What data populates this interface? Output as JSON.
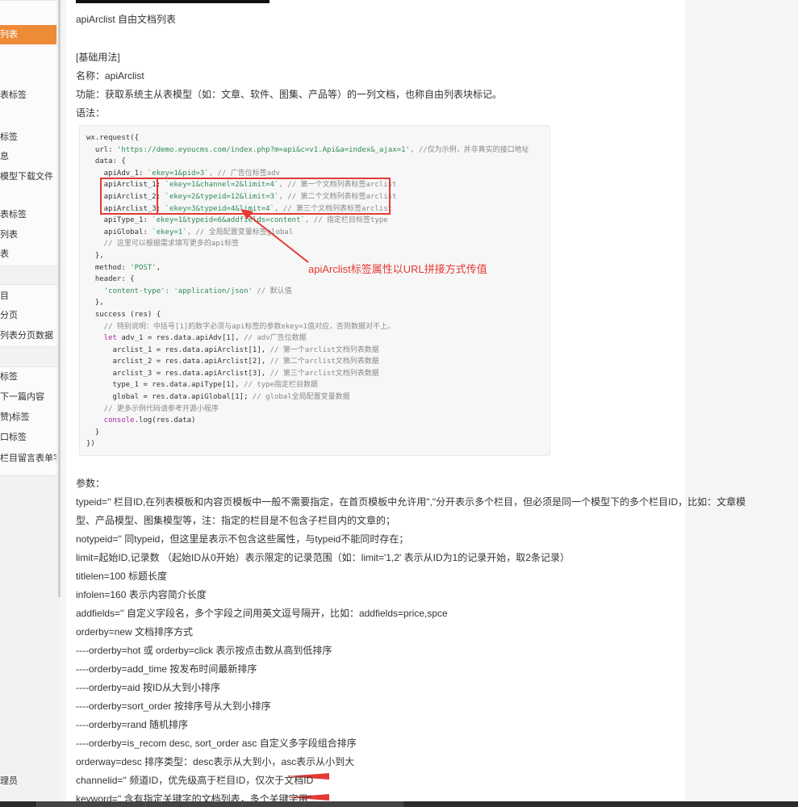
{
  "sidebar": {
    "items": [
      {
        "label": "列表",
        "active": true
      },
      {
        "label": "表标签"
      },
      {
        "label": "标签"
      },
      {
        "label": "息"
      },
      {
        "label": "模型下载文件"
      },
      {
        "label": "表标签"
      },
      {
        "label": "列表"
      },
      {
        "label": "表"
      },
      {
        "label": "目"
      },
      {
        "label": "分页"
      },
      {
        "label": "列表分页数据"
      },
      {
        "label": "标签"
      },
      {
        "label": "下一篇内容"
      },
      {
        "label": "赞)标签"
      },
      {
        "label": "口标签"
      },
      {
        "label": "栏目留言表单字"
      },
      {
        "label": "理员"
      }
    ]
  },
  "content": {
    "subtitle": "apiArclist 自由文档列表",
    "section_label": "[基础用法]",
    "name_line": "名称：apiArclist",
    "function_line": "功能：获取系统主从表模型（如：文章、软件、图集、产品等）的一列文档，也称自由列表块标记。",
    "syntax_label": "语法：",
    "code": {
      "l01": "wx.request({",
      "l02_a": "  url: ",
      "l02_s": "'https://demo.eyoucms.com/index.php?m=api&c=v1.Api&a=index&_ajax=1'",
      "l02_c": ", //仅为示例，并非真实的接口地址",
      "l03": "  data: {",
      "l04_a": "    apiAdv_1: ",
      "l04_s": "`ekey=1&pid=3`",
      "l04_c": ", // 广告位标签adv",
      "l05_a": "    apiArclist_1: ",
      "l05_s": "`ekey=1&channel=2&limit=4`",
      "l05_c": ", // 第一个文档列表标签arclist",
      "l06_a": "    apiArclist_2: ",
      "l06_s": "`ekey=2&typeid=12&limit=3`",
      "l06_c": ", // 第二个文档列表标签arclist",
      "l07_a": "    apiArclist_3: ",
      "l07_s": "`ekey=3&typeid=4&limit=4`",
      "l07_c": ", // 第三个文档列表标签arclist",
      "l08_a": "    apiType_1: ",
      "l08_s": "`ekey=1&typeid=6&addfields=content`",
      "l08_c": ", // 指定栏目标签type",
      "l09_a": "    apiGlobal: ",
      "l09_s": "`ekey=1`",
      "l09_c": ", // 全局配置变量标签global",
      "l10": "    // 这里可以根据需求填写更多的api标签",
      "l11": "  },",
      "l12_a": "  method: ",
      "l12_s": "'POST'",
      "l12_c": ",",
      "l13": "  header: {",
      "l14_a": "    ",
      "l14_s": "'content-type': 'application/json'",
      "l14_c": " // 默认值",
      "l15": "  },",
      "l16": "  success (res) {",
      "l17": "    // 特别说明：中括号[1]的数字必须与api标签的参数ekey=1值对应，否则数据对不上。",
      "l18_k": "    let",
      "l18_a": " adv_1 = res.data.apiAdv[1], ",
      "l18_c": "// adv广告位数据",
      "l19_a": "      arclist_1 = res.data.apiArclist[1], ",
      "l19_c": "// 第一个arclist文档列表数据",
      "l20_a": "      arclist_2 = res.data.apiArclist[2], ",
      "l20_c": "// 第二个arclist文档列表数据",
      "l21_a": "      arclist_3 = res.data.apiArclist[3], ",
      "l21_c": "// 第三个arclist文档列表数据",
      "l22_a": "      type_1 = res.data.apiType[1], ",
      "l22_c": "// type指定栏目数据",
      "l23_a": "      global = res.data.apiGlobal[1]; ",
      "l23_c": "// global全局配置变量数据",
      "l24": "    // 更多示例代码请参考开源小程序",
      "l25_k": "    console",
      "l25_a": ".log(res.data)",
      "l26": "  }",
      "l27": "})"
    },
    "annotation": "apiArclist标签属性以URL拼接方式传值",
    "params_label": "参数：",
    "params": [
      "typeid='' 栏目ID,在列表模板和内容页模板中一般不需要指定，在首页模板中允许用\",\"分开表示多个栏目，但必须是同一个模型下的多个栏目ID，比如：文章模",
      "型、产品模型、图集模型等，注：指定的栏目是不包含子栏目内的文章的；",
      "notypeid='' 同typeid，但这里是表示不包含这些属性，与typeid不能同时存在；",
      "limit=起始ID,记录数 （起始ID从0开始）表示限定的记录范围（如：limit='1,2' 表示从ID为1的记录开始，取2条记录）",
      "titlelen=100 标题长度",
      "infolen=160 表示内容简介长度",
      "addfields='' 自定义字段名，多个字段之间用英文逗号隔开，比如：addfields=price,spce",
      "orderby=new 文档排序方式",
      "----orderby=hot 或 orderby=click 表示按点击数从高到低排序",
      "----orderby=add_time 按发布时间最新排序",
      "----orderby=aid 按ID从大到小排序",
      "----orderby=sort_order 按排序号从大到小排序",
      "----orderby=rand 随机排序",
      "----orderby=is_recom desc, sort_order asc 自定义多字段组合排序",
      "orderway=desc 排序类型：desc表示从大到小，asc表示从小到大",
      "channelid='' 频道ID，优先级高于栏目ID，仅次于文档ID",
      "keyword='' 含有指定关键字的文档列表，多个关键字用\","
    ]
  },
  "colors": {
    "accent": "#ee8b37",
    "highlight": "#e53935"
  }
}
